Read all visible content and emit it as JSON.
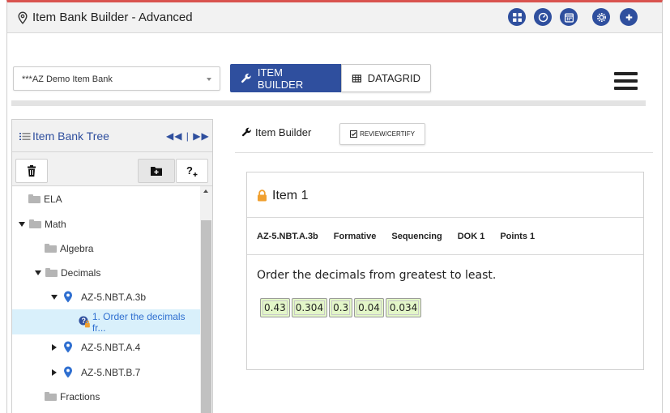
{
  "window": {
    "title": "Item Bank Builder - Advanced",
    "accent_color": "#2f4f9e",
    "top_border_color": "#d9534f",
    "toolbar_icons": [
      "grid-icon",
      "gauge-icon",
      "calendar-icon",
      "gear-icon",
      "plus-icon"
    ]
  },
  "bank_selector": {
    "value": "***AZ Demo Item Bank"
  },
  "view_tabs": [
    {
      "label": "ITEM BUILDER",
      "icon": "wrench-icon",
      "active": true
    },
    {
      "label": "DATAGRID",
      "icon": "table-icon",
      "active": false
    }
  ],
  "tree_panel": {
    "title": "Item Bank Tree",
    "nav_arrows": "◀◀ | ▶▶",
    "tools": [
      "trash-icon",
      "add-folder-icon",
      "add-question-icon"
    ],
    "nodes": [
      {
        "label": "ELA",
        "type": "folder",
        "depth": 0,
        "toggle": "none"
      },
      {
        "label": "Math",
        "type": "folder",
        "depth": 0,
        "toggle": "expanded"
      },
      {
        "label": "Algebra",
        "type": "folder",
        "depth": 1,
        "toggle": "none"
      },
      {
        "label": "Decimals",
        "type": "folder",
        "depth": 1,
        "toggle": "expanded"
      },
      {
        "label": "AZ-5.NBT.A.3b",
        "type": "standard",
        "depth": 2,
        "toggle": "expanded"
      },
      {
        "label": "1. Order the decimals fr...",
        "type": "question",
        "depth": 3,
        "toggle": "none",
        "selected": true
      },
      {
        "label": "AZ-5.NBT.A.4",
        "type": "standard",
        "depth": 2,
        "toggle": "collapsed"
      },
      {
        "label": "AZ-5.NBT.B.7",
        "type": "standard",
        "depth": 2,
        "toggle": "collapsed"
      },
      {
        "label": "Fractions",
        "type": "folder",
        "depth": 1,
        "toggle": "none"
      }
    ]
  },
  "item_builder": {
    "header": "Item Builder",
    "review_button": "REVIEW/CERTIFY",
    "item": {
      "title": "Item 1",
      "meta": [
        "AZ-5.NBT.A.3b",
        "Formative",
        "Sequencing",
        "DOK 1",
        "Points 1"
      ],
      "prompt": "Order the decimals from greatest to least.",
      "choices": [
        "0.43",
        "0.304",
        "0.3",
        "0.04",
        "0.034"
      ]
    }
  }
}
